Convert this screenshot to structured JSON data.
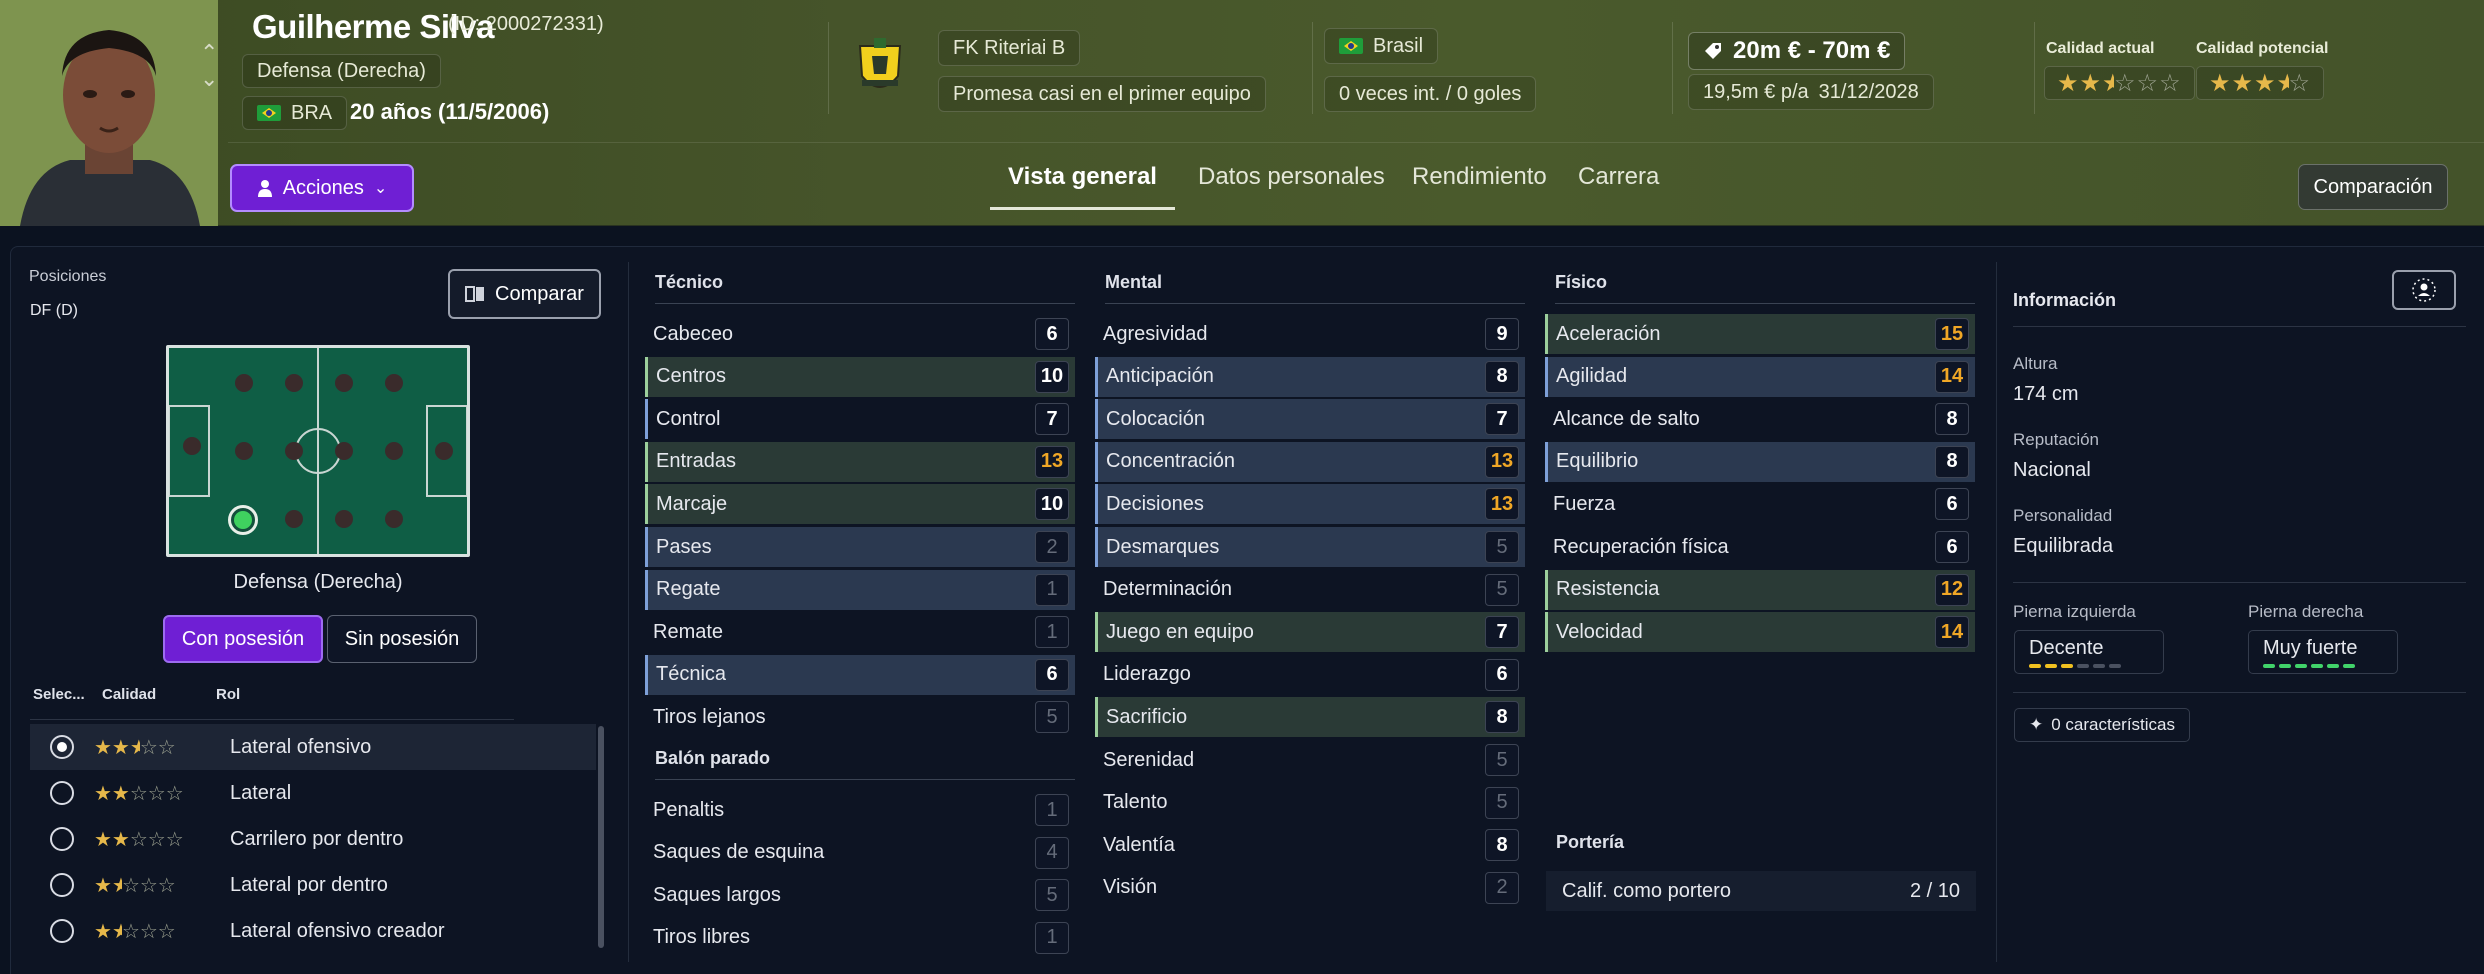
{
  "header": {
    "player_name": "Guilherme Silva",
    "player_id": "(ID: 2000272331)",
    "position": "Defensa (Derecha)",
    "nationality_code": "BRA",
    "age_birth": "20 años (11/5/2006)",
    "club": "FK Riteriai B",
    "club_status": "Promesa casi en el primer equipo",
    "national_team": "Brasil",
    "intl_caps": "0 veces int. / 0 goles",
    "value": "20m € - 70m €",
    "wage": "19,5m € p/a",
    "contract_end": "31/12/2028",
    "current_quality_label": "Calidad actual",
    "potential_quality_label": "Calidad potencial",
    "current_quality_stars": 2.5,
    "potential_quality_stars": 3.5,
    "actions_label": "Acciones",
    "compare_label": "Comparación",
    "tabs": [
      {
        "label": "Vista general",
        "active": true
      },
      {
        "label": "Datos personales",
        "active": false
      },
      {
        "label": "Rendimiento",
        "active": false
      },
      {
        "label": "Carrera",
        "active": false
      }
    ]
  },
  "positions": {
    "title": "Posiciones",
    "code": "DF (D)",
    "compare_button": "Comparar",
    "pitch_position_label": "Defensa (Derecha)",
    "toggle_with": "Con posesión",
    "toggle_without": "Sin posesión",
    "col_select": "Selec...",
    "col_quality": "Calidad",
    "col_role": "Rol",
    "roles": [
      {
        "name": "Lateral ofensivo",
        "stars": 2.5,
        "selected": true
      },
      {
        "name": "Lateral",
        "stars": 2,
        "selected": false
      },
      {
        "name": "Carrilero por dentro",
        "stars": 2,
        "selected": false
      },
      {
        "name": "Lateral por dentro",
        "stars": 1.5,
        "selected": false
      },
      {
        "name": "Lateral ofensivo creador",
        "stars": 1.5,
        "selected": false
      }
    ]
  },
  "tecnico": {
    "title": "Técnico",
    "rows": [
      {
        "name": "Cabeceo",
        "value": "6",
        "tone": "w",
        "bg": "",
        "bar": ""
      },
      {
        "name": "Centros",
        "value": "10",
        "tone": "w",
        "bg": "gr",
        "bar": "lg"
      },
      {
        "name": "Control",
        "value": "7",
        "tone": "w",
        "bg": "",
        "bar": "lb"
      },
      {
        "name": "Entradas",
        "value": "13",
        "tone": "o",
        "bg": "gr",
        "bar": "lg"
      },
      {
        "name": "Marcaje",
        "value": "10",
        "tone": "w",
        "bg": "gr",
        "bar": "lg"
      },
      {
        "name": "Pases",
        "value": "2",
        "tone": "g",
        "bg": "hl",
        "bar": "lb"
      },
      {
        "name": "Regate",
        "value": "1",
        "tone": "g",
        "bg": "hl",
        "bar": "lb"
      },
      {
        "name": "Remate",
        "value": "1",
        "tone": "g",
        "bg": "",
        "bar": ""
      },
      {
        "name": "Técnica",
        "value": "6",
        "tone": "w",
        "bg": "hl",
        "bar": "lb"
      },
      {
        "name": "Tiros lejanos",
        "value": "5",
        "tone": "g",
        "bg": "",
        "bar": ""
      }
    ]
  },
  "balon_parado": {
    "title": "Balón parado",
    "rows": [
      {
        "name": "Penaltis",
        "value": "1",
        "tone": "g",
        "bg": "",
        "bar": ""
      },
      {
        "name": "Saques de esquina",
        "value": "4",
        "tone": "g",
        "bg": "",
        "bar": ""
      },
      {
        "name": "Saques largos",
        "value": "5",
        "tone": "g",
        "bg": "",
        "bar": ""
      },
      {
        "name": "Tiros libres",
        "value": "1",
        "tone": "g",
        "bg": "",
        "bar": ""
      }
    ]
  },
  "mental": {
    "title": "Mental",
    "rows": [
      {
        "name": "Agresividad",
        "value": "9",
        "tone": "w",
        "bg": "",
        "bar": ""
      },
      {
        "name": "Anticipación",
        "value": "8",
        "tone": "w",
        "bg": "hl",
        "bar": "lb"
      },
      {
        "name": "Colocación",
        "value": "7",
        "tone": "w",
        "bg": "hl",
        "bar": "lb"
      },
      {
        "name": "Concentración",
        "value": "13",
        "tone": "o",
        "bg": "hl",
        "bar": "lb"
      },
      {
        "name": "Decisiones",
        "value": "13",
        "tone": "o",
        "bg": "hl",
        "bar": "lb"
      },
      {
        "name": "Desmarques",
        "value": "5",
        "tone": "g",
        "bg": "hl",
        "bar": "lb"
      },
      {
        "name": "Determinación",
        "value": "5",
        "tone": "g",
        "bg": "",
        "bar": ""
      },
      {
        "name": "Juego en equipo",
        "value": "7",
        "tone": "w",
        "bg": "gr",
        "bar": "lg"
      },
      {
        "name": "Liderazgo",
        "value": "6",
        "tone": "w",
        "bg": "",
        "bar": ""
      },
      {
        "name": "Sacrificio",
        "value": "8",
        "tone": "w",
        "bg": "gr",
        "bar": "lg"
      },
      {
        "name": "Serenidad",
        "value": "5",
        "tone": "g",
        "bg": "",
        "bar": ""
      },
      {
        "name": "Talento",
        "value": "5",
        "tone": "g",
        "bg": "",
        "bar": ""
      },
      {
        "name": "Valentía",
        "value": "8",
        "tone": "w",
        "bg": "",
        "bar": ""
      },
      {
        "name": "Visión",
        "value": "2",
        "tone": "g",
        "bg": "",
        "bar": ""
      }
    ]
  },
  "fisico": {
    "title": "Físico",
    "rows": [
      {
        "name": "Aceleración",
        "value": "15",
        "tone": "o",
        "bg": "gr",
        "bar": "lg"
      },
      {
        "name": "Agilidad",
        "value": "14",
        "tone": "o",
        "bg": "hl",
        "bar": "lb"
      },
      {
        "name": "Alcance de salto",
        "value": "8",
        "tone": "w",
        "bg": "",
        "bar": ""
      },
      {
        "name": "Equilibrio",
        "value": "8",
        "tone": "w",
        "bg": "hl",
        "bar": "lb"
      },
      {
        "name": "Fuerza",
        "value": "6",
        "tone": "w",
        "bg": "",
        "bar": ""
      },
      {
        "name": "Recuperación física",
        "value": "6",
        "tone": "w",
        "bg": "",
        "bar": ""
      },
      {
        "name": "Resistencia",
        "value": "12",
        "tone": "o",
        "bg": "gr",
        "bar": "lg"
      },
      {
        "name": "Velocidad",
        "value": "14",
        "tone": "o",
        "bg": "gr",
        "bar": "lg"
      }
    ]
  },
  "porteria": {
    "title": "Portería",
    "label": "Calif. como portero",
    "value": "2 / 10"
  },
  "info": {
    "title": "Información",
    "height_label": "Altura",
    "height": "174 cm",
    "reputation_label": "Reputación",
    "reputation": "Nacional",
    "personality_label": "Personalidad",
    "personality": "Equilibrada",
    "left_foot_label": "Pierna izquierda",
    "left_foot": "Decente",
    "left_foot_level": 3,
    "right_foot_label": "Pierna derecha",
    "right_foot": "Muy fuerte",
    "right_foot_level": 6,
    "traits": "0 características"
  }
}
